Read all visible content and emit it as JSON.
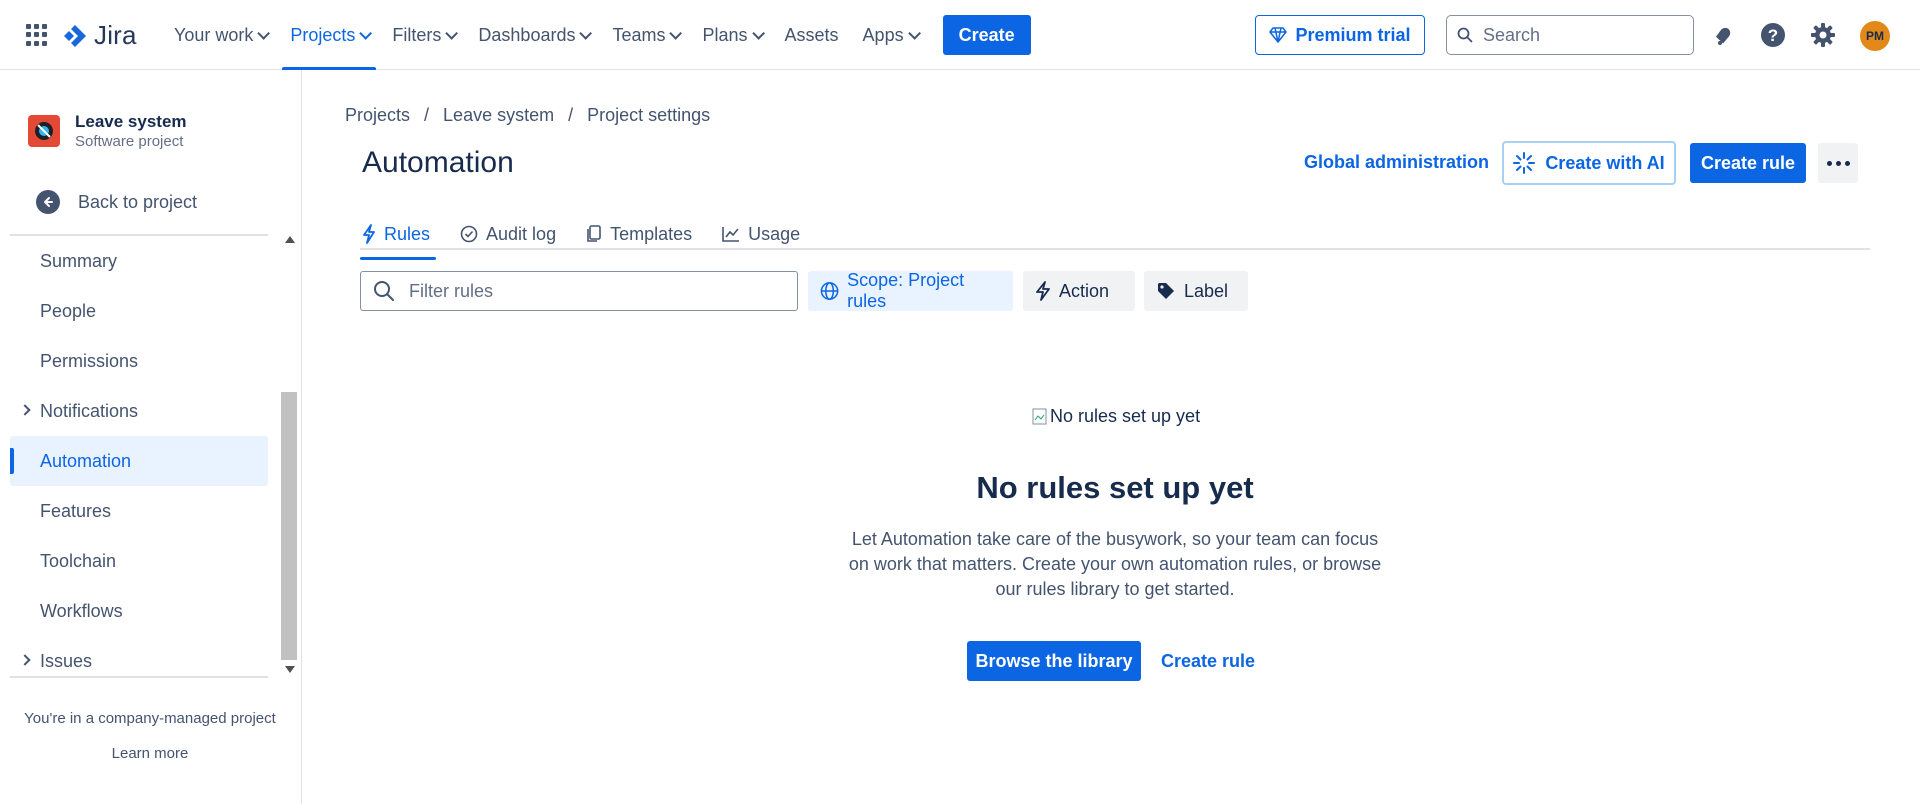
{
  "topnav": {
    "logo_text": "Jira",
    "links": [
      {
        "label": "Your work",
        "dropdown": true
      },
      {
        "label": "Projects",
        "dropdown": true,
        "active": true
      },
      {
        "label": "Filters",
        "dropdown": true
      },
      {
        "label": "Dashboards",
        "dropdown": true
      },
      {
        "label": "Teams",
        "dropdown": true
      },
      {
        "label": "Plans",
        "dropdown": true
      },
      {
        "label": "Assets",
        "dropdown": false
      },
      {
        "label": "Apps",
        "dropdown": true
      }
    ],
    "create_label": "Create",
    "premium_label": "Premium trial",
    "search_placeholder": "Search",
    "avatar_initials": "PM"
  },
  "sidebar": {
    "project_name": "Leave system",
    "project_type": "Software project",
    "back_label": "Back to project",
    "items": [
      {
        "label": "Summary",
        "expandable": false
      },
      {
        "label": "People",
        "expandable": false
      },
      {
        "label": "Permissions",
        "expandable": false
      },
      {
        "label": "Notifications",
        "expandable": true
      },
      {
        "label": "Automation",
        "expandable": false,
        "active": true
      },
      {
        "label": "Features",
        "expandable": false
      },
      {
        "label": "Toolchain",
        "expandable": false
      },
      {
        "label": "Workflows",
        "expandable": false
      },
      {
        "label": "Issues",
        "expandable": true
      }
    ],
    "company_note": "You're in a company-managed project",
    "learn_more": "Learn more"
  },
  "main": {
    "breadcrumb": [
      "Projects",
      "Leave system",
      "Project settings"
    ],
    "title": "Automation",
    "global_admin": "Global administration",
    "create_ai": "Create with AI",
    "create_rule": "Create rule",
    "tabs": [
      "Rules",
      "Audit log",
      "Templates",
      "Usage"
    ],
    "filter_placeholder": "Filter rules",
    "chips": {
      "scope": "Scope: Project rules",
      "action": "Action",
      "label": "Label"
    },
    "empty": {
      "image_alt": "No rules set up yet",
      "title": "No rules set up yet",
      "description": "Let Automation take care of the busywork, so your team can focus on work that matters. Create your own automation rules, or browse our rules library to get started.",
      "browse_label": "Browse the library",
      "create_rule_label": "Create rule"
    }
  },
  "colors": {
    "brand": "#0c66e4",
    "text": "#172b4d",
    "subtle": "#44546f"
  }
}
